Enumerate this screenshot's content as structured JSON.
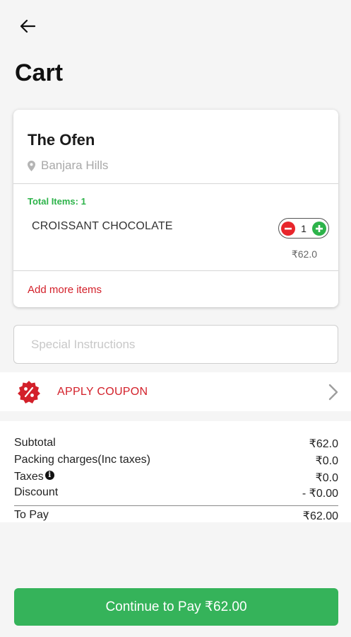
{
  "header": {
    "back_icon": "arrow-left-icon",
    "title": "Cart"
  },
  "store": {
    "name": "The Ofen",
    "location": "Banjara Hills",
    "location_icon": "map-pin-icon"
  },
  "order": {
    "total_items_label": "Total Items: 1",
    "items": [
      {
        "name": "CROISSANT CHOCOLATE",
        "quantity": "1",
        "price": "₹62.0"
      }
    ],
    "add_more_label": "Add more items"
  },
  "instructions": {
    "placeholder": "Special Instructions"
  },
  "coupon": {
    "icon": "percent-badge-icon",
    "label": "APPLY COUPON"
  },
  "bill": {
    "subtotal_label": "Subtotal",
    "subtotal_value": "₹62.0",
    "packing_label": "Packing charges(Inc taxes)",
    "packing_value": "₹0.0",
    "taxes_label": "Taxes",
    "taxes_value": "₹0.0",
    "discount_label": "Discount",
    "discount_value": "- ₹0.00",
    "to_pay_label": "To Pay",
    "to_pay_value": "₹62.00"
  },
  "footer": {
    "pay_button_label": "Continue to Pay ₹62.00"
  },
  "colors": {
    "accent_green": "#35b35a",
    "accent_red": "#d3202a",
    "background": "#f5f5f5"
  }
}
